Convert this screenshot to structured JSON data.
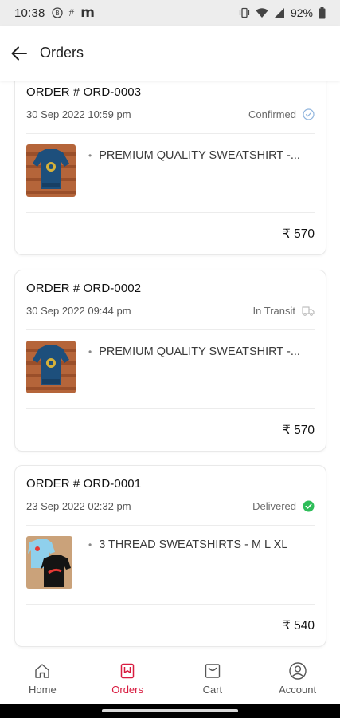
{
  "status_bar": {
    "time": "10:38",
    "battery": "92%",
    "icons": [
      "b-circle-icon",
      "hash-icon",
      "m-app-icon",
      "vibrate-icon",
      "wifi-icon",
      "signal-icon",
      "battery-icon"
    ],
    "m_glyph": "m",
    "hash_glyph": "#"
  },
  "app_bar": {
    "title": "Orders",
    "back_icon": "arrow-left-icon"
  },
  "orders": [
    {
      "order_label": "ORDER # ORD-0003",
      "date": "30 Sep 2022 10:59 pm",
      "status": "Confirmed",
      "status_icon": "check-circle-outline-icon",
      "item_name": "PREMIUM QUALITY SWEATSHIRT -...",
      "bullet": "•",
      "price": "₹ 570"
    },
    {
      "order_label": "ORDER # ORD-0002",
      "date": "30 Sep 2022 09:44 pm",
      "status": "In Transit",
      "status_icon": "truck-icon",
      "item_name": "PREMIUM QUALITY SWEATSHIRT -...",
      "bullet": "•",
      "price": "₹ 570"
    },
    {
      "order_label": "ORDER # ORD-0001",
      "date": "23 Sep 2022 02:32 pm",
      "status": "Delivered",
      "status_icon": "check-circle-filled-icon",
      "item_name": "3 THREAD SWEATSHIRTS - M L XL",
      "bullet": "•",
      "price": "₹ 540"
    }
  ],
  "bottom_nav": {
    "items": [
      {
        "label": "Home",
        "icon": "home-icon",
        "active": false
      },
      {
        "label": "Orders",
        "icon": "orders-icon",
        "active": true
      },
      {
        "label": "Cart",
        "icon": "cart-icon",
        "active": false
      },
      {
        "label": "Account",
        "icon": "account-icon",
        "active": false
      }
    ]
  },
  "colors": {
    "accent": "#d81b3f",
    "delivered": "#2ebd59",
    "confirmed": "#8fb4dd",
    "status_bar_bg": "#ededed"
  }
}
